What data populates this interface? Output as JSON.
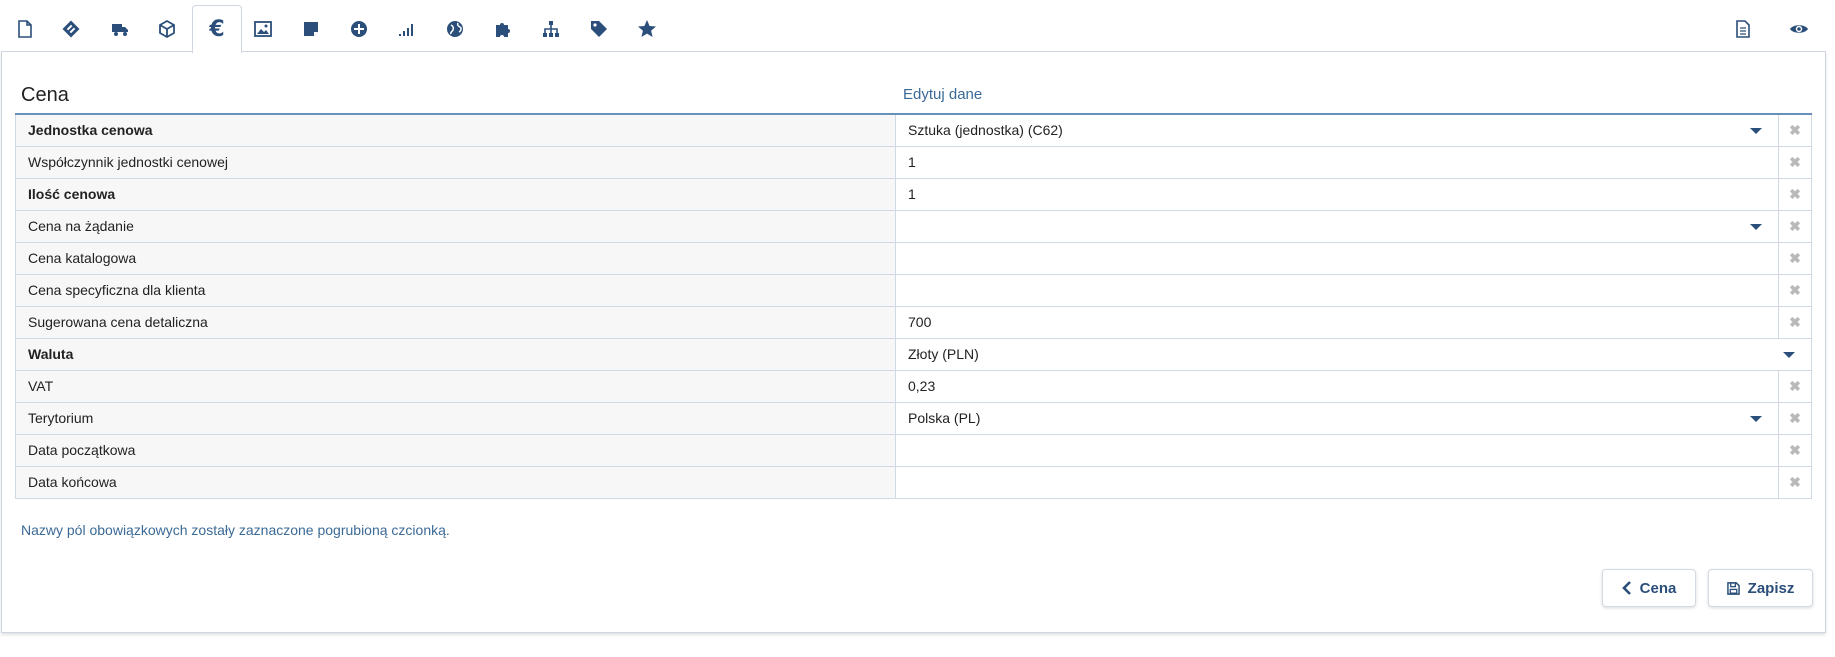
{
  "toolbar": {
    "tabs": [
      {
        "icon": "document-icon"
      },
      {
        "icon": "barcode-icon"
      },
      {
        "icon": "truck-icon"
      },
      {
        "icon": "cube-icon"
      },
      {
        "icon": "euro-icon",
        "label": "€",
        "active": true
      },
      {
        "icon": "image-icon"
      },
      {
        "icon": "note-icon"
      },
      {
        "icon": "plus-circle-icon"
      },
      {
        "icon": "signal-bars-icon"
      },
      {
        "icon": "globe-icon"
      },
      {
        "icon": "puzzle-icon"
      },
      {
        "icon": "sitemap-icon"
      },
      {
        "icon": "tag-icon"
      },
      {
        "icon": "star-icon"
      }
    ],
    "right_icons": [
      "report-icon",
      "eye-icon"
    ],
    "accent_color": "#2b4f7a"
  },
  "panel": {
    "title": "Cena",
    "edit_link": "Edytuj dane"
  },
  "fields": [
    {
      "label": "Jednostka cenowa",
      "value": "Sztuka (jednostka) (C62)"
    },
    {
      "label": "Współczynnik jednostki cenowej",
      "value": "1"
    },
    {
      "label": "Ilość cenowa",
      "value": "1"
    },
    {
      "label": "Cena na żądanie",
      "value": ""
    },
    {
      "label": "Cena katalogowa",
      "value": ""
    },
    {
      "label": "Cena specyficzna dla klienta",
      "value": ""
    },
    {
      "label": "Sugerowana cena detaliczna",
      "value": "700"
    },
    {
      "label": "Waluta",
      "value": "Złoty (PLN)"
    },
    {
      "label": "VAT",
      "value": "0,23"
    },
    {
      "label": "Terytorium",
      "value": "Polska (PL)"
    },
    {
      "label": "Data początkowa",
      "value": ""
    },
    {
      "label": "Data końcowa",
      "value": ""
    }
  ],
  "clear_symbol": "✖",
  "note": "Nazwy pól obowiązkowych zostały zaznaczone pogrubioną czcionką.",
  "buttons": {
    "back_label": "Cena",
    "save_label": "Zapisz"
  }
}
